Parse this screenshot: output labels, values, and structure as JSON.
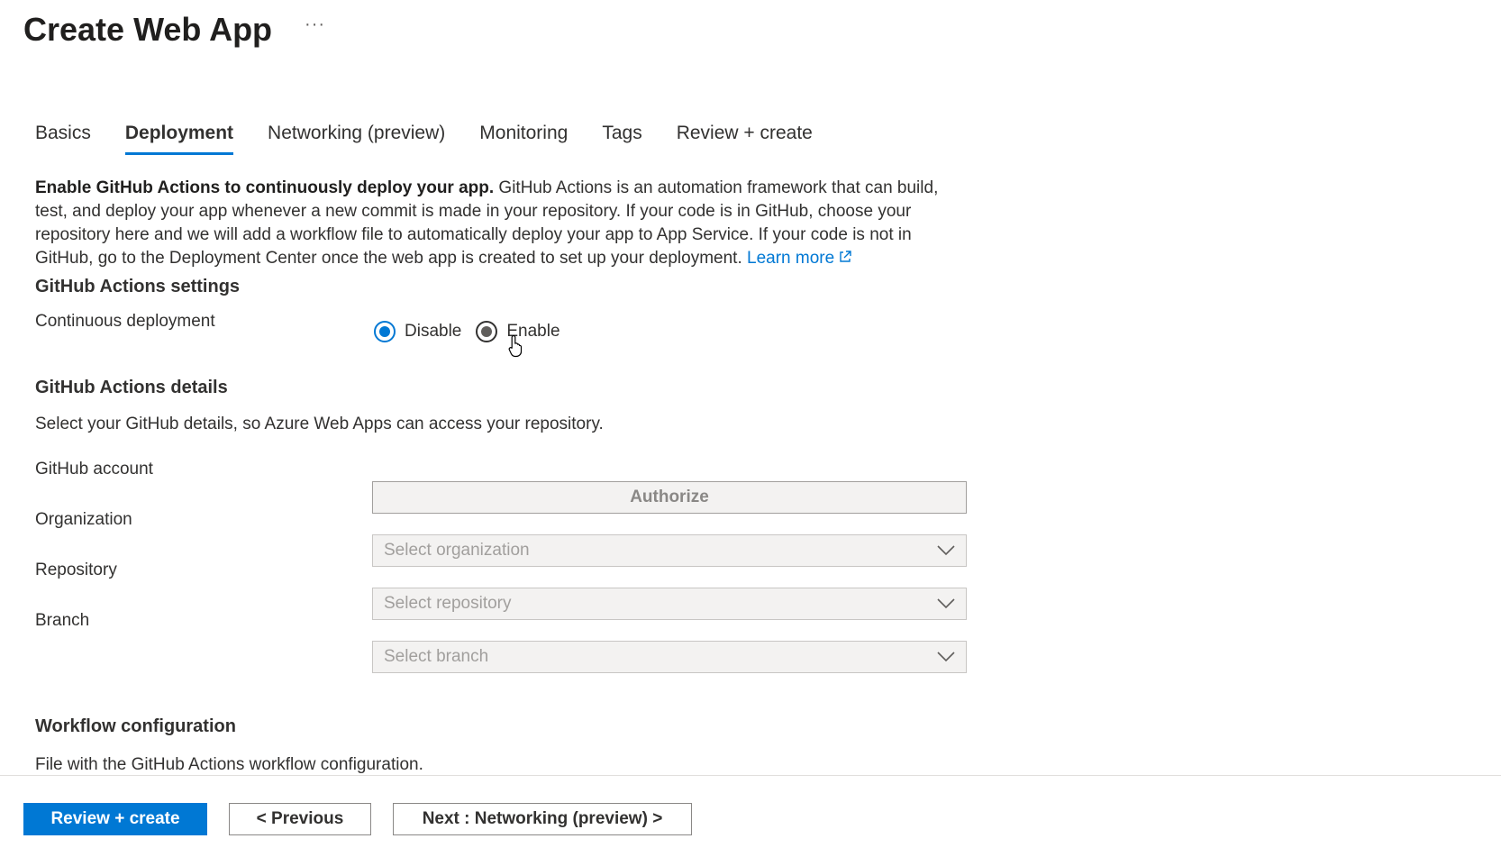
{
  "header": {
    "title": "Create Web App",
    "more": "···"
  },
  "tabs": [
    {
      "label": "Basics",
      "active": false
    },
    {
      "label": "Deployment",
      "active": true
    },
    {
      "label": "Networking (preview)",
      "active": false
    },
    {
      "label": "Monitoring",
      "active": false
    },
    {
      "label": "Tags",
      "active": false
    },
    {
      "label": "Review + create",
      "active": false
    }
  ],
  "intro": {
    "bold": "Enable GitHub Actions to continuously deploy your app.",
    "text": " GitHub Actions is an automation framework that can build, test, and deploy your app whenever a new commit is made in your repository. If your code is in GitHub, choose your repository here and we will add a workflow file to automatically deploy your app to App Service. If your code is not in GitHub, go to the Deployment Center once the web app is created to set up your deployment. ",
    "link": "Learn more"
  },
  "settings": {
    "title": "GitHub Actions settings",
    "continuous_label": "Continuous deployment",
    "options": {
      "disable": "Disable",
      "enable": "Enable"
    },
    "selected": "Disable"
  },
  "details": {
    "title": "GitHub Actions details",
    "description": "Select your GitHub details, so Azure Web Apps can access your repository.",
    "account_label": "GitHub account",
    "authorize": "Authorize",
    "organization_label": "Organization",
    "organization_placeholder": "Select organization",
    "repository_label": "Repository",
    "repository_placeholder": "Select repository",
    "branch_label": "Branch",
    "branch_placeholder": "Select branch"
  },
  "workflow": {
    "title": "Workflow configuration",
    "description": "File with the GitHub Actions workflow configuration."
  },
  "footer": {
    "review": "Review + create",
    "previous": "< Previous",
    "next": "Next : Networking (preview) >"
  },
  "colors": {
    "accent": "#0078d4",
    "text": "#323130",
    "disabled_bg": "#f3f2f1"
  }
}
